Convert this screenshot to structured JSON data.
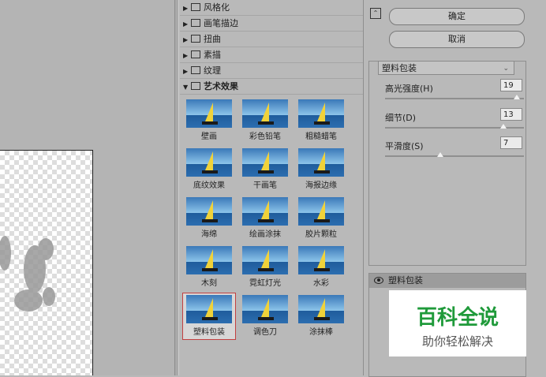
{
  "gallery": {
    "categories": [
      {
        "label": "风格化",
        "open": false
      },
      {
        "label": "画笔描边",
        "open": false
      },
      {
        "label": "扭曲",
        "open": false
      },
      {
        "label": "素描",
        "open": false
      },
      {
        "label": "纹理",
        "open": false
      },
      {
        "label": "艺术效果",
        "open": true
      }
    ],
    "arrows": {
      "closed": "▶",
      "open": "▼"
    },
    "thumbs": [
      "壁画",
      "彩色铅笔",
      "粗糙蜡笔",
      "底纹效果",
      "干画笔",
      "海报边缘",
      "海绵",
      "绘画涂抹",
      "胶片颗粒",
      "木刻",
      "霓虹灯光",
      "水彩",
      "塑料包装",
      "调色刀",
      "涂抹棒"
    ],
    "selected": "塑料包装"
  },
  "buttons": {
    "ok": "确定",
    "cancel": "取消"
  },
  "collapse_icon": "⌃",
  "filter_select": {
    "value": "塑料包装",
    "chevron": "⌄"
  },
  "params": [
    {
      "label": "高光强度(H)",
      "value": "19",
      "level": 0.95
    },
    {
      "label": "细节(D)",
      "value": "13",
      "level": 0.85
    },
    {
      "label": "平滑度(S)",
      "value": "7",
      "level": 0.4
    }
  ],
  "layers": {
    "name": "塑料包装"
  },
  "watermark": {
    "title": "百科全说",
    "subtitle": "助你轻松解决"
  },
  "colors": {
    "selected_border": "#c24040",
    "watermark_green": "#1f9a3a"
  }
}
